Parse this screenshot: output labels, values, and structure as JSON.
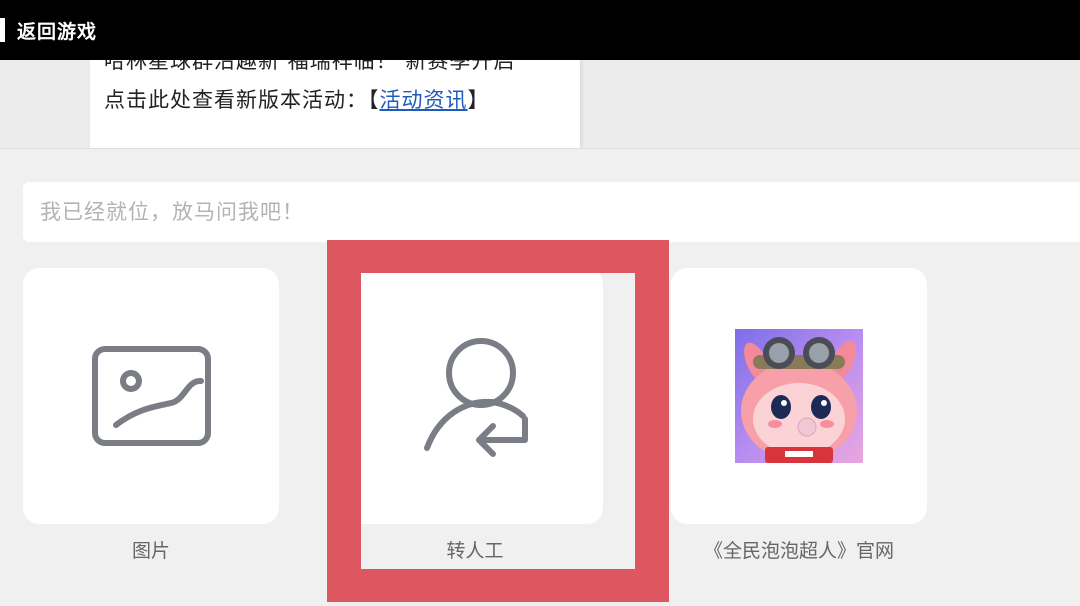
{
  "header": {
    "back_label": "返回游戏"
  },
  "chat": {
    "line1": "哈林星球群沿趣新 福瑞祥临！ 新赛季开启",
    "line2_prefix": "点击此处查看新版本活动：【",
    "link_text": "活动资讯",
    "line2_suffix": "】"
  },
  "input": {
    "placeholder": "我已经就位，放马问我吧！"
  },
  "tiles": [
    {
      "label": "图片",
      "icon": "image-icon"
    },
    {
      "label": "转人工",
      "icon": "transfer-to-human-icon"
    },
    {
      "label": "《全民泡泡超人》官网",
      "icon": "game-avatar"
    }
  ],
  "colors": {
    "highlight": "#dd5760",
    "link": "#1f5bbd",
    "icon_gray": "#7a7d85"
  }
}
